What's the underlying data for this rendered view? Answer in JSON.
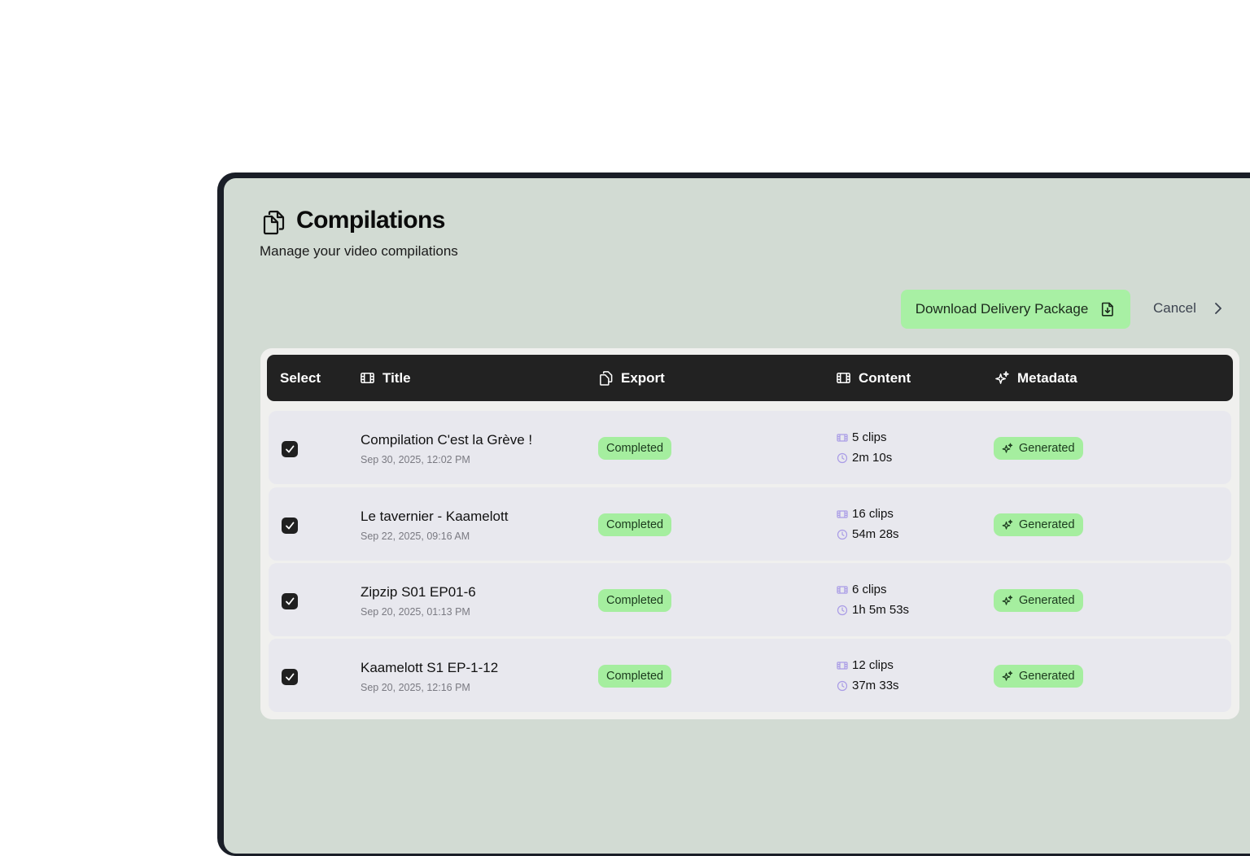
{
  "header": {
    "title": "Compilations",
    "subtitle": "Manage your video compilations",
    "icon": "copy-icon"
  },
  "actions": {
    "download_label": "Download Delivery Package",
    "download_icon": "file-download-icon",
    "cancel_label": "Cancel",
    "cancel_icon": "chevron-right-icon"
  },
  "table": {
    "columns": [
      {
        "label": "Select",
        "icon": ""
      },
      {
        "label": "Title",
        "icon": "film-icon"
      },
      {
        "label": "Export",
        "icon": "copy-icon"
      },
      {
        "label": "Content",
        "icon": "film-icon"
      },
      {
        "label": "Metadata",
        "icon": "sparkles-icon"
      }
    ],
    "rows": [
      {
        "selected": true,
        "title": "Compilation C'est la Grève !",
        "date": "Sep 30, 2025, 12:02 PM",
        "export_status": "Completed",
        "clips": "5 clips",
        "duration": "2m 10s",
        "metadata": "Generated"
      },
      {
        "selected": true,
        "title": "Le tavernier - Kaamelott",
        "date": "Sep 22, 2025, 09:16 AM",
        "export_status": "Completed",
        "clips": "16 clips",
        "duration": "54m 28s",
        "metadata": "Generated"
      },
      {
        "selected": true,
        "title": "Zipzip S01 EP01-6",
        "date": "Sep 20, 2025, 01:13 PM",
        "export_status": "Completed",
        "clips": "6 clips",
        "duration": "1h 5m 53s",
        "metadata": "Generated"
      },
      {
        "selected": true,
        "title": "Kaamelott S1 EP-1-12",
        "date": "Sep 20, 2025, 12:16 PM",
        "export_status": "Completed",
        "clips": "12 clips",
        "duration": "37m 33s",
        "metadata": "Generated"
      }
    ]
  },
  "colors": {
    "background": "#d2dbd3",
    "accent_green": "#a5ee9f",
    "header_dark": "#222222",
    "row_bg": "#e8e8ee",
    "content_icon": "#a99be6"
  }
}
